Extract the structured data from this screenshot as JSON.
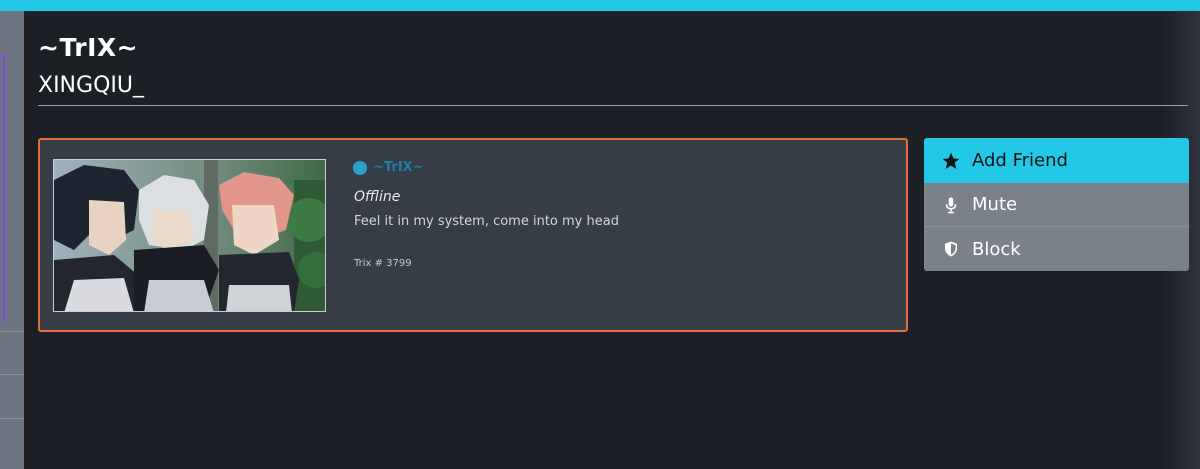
{
  "header": {
    "title": "~TrIX~",
    "subtitle": "XINGQIU_"
  },
  "profile": {
    "username": "~TrIX~",
    "status": "Offline",
    "bio": "Feel it in my system, come into my head",
    "tag": "Trix # 3799",
    "status_color": "#2aa1c9",
    "border_color": "#e0703a"
  },
  "actions": {
    "add_friend": {
      "label": "Add Friend",
      "icon": "star-icon"
    },
    "mute": {
      "label": "Mute",
      "icon": "microphone-icon"
    },
    "block": {
      "label": "Block",
      "icon": "shield-icon"
    }
  },
  "colors": {
    "accent": "#22c8e5",
    "background": "#1c1f26",
    "card": "#363d47"
  }
}
